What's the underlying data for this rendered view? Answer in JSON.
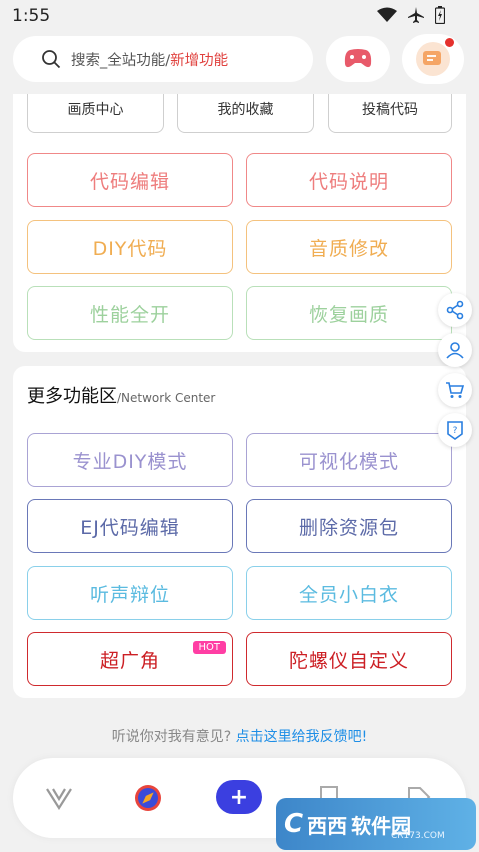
{
  "status": {
    "time": "1:55"
  },
  "search": {
    "placeholder": "搜索_全站功能/",
    "accent": "新增功能"
  },
  "top_tabs": [
    "画质中心",
    "我的收藏",
    "投稿代码"
  ],
  "section1_buttons": [
    {
      "label": "代码编辑",
      "color": "#ee7d7d"
    },
    {
      "label": "代码说明",
      "color": "#ee7d7d"
    },
    {
      "label": "DIY代码",
      "color": "#f0ad52"
    },
    {
      "label": "音质修改",
      "color": "#f0ad52"
    },
    {
      "label": "性能全开",
      "color": "#9dd19d"
    },
    {
      "label": "恢复画质",
      "color": "#9dd19d"
    }
  ],
  "section2": {
    "title": "更多功能区",
    "subtitle": "/Network Center",
    "buttons": [
      {
        "label": "专业DIY模式",
        "color": "#9a92cf"
      },
      {
        "label": "可视化模式",
        "color": "#9a92cf"
      },
      {
        "label": "EJ代码编辑",
        "color": "#5c6aa8"
      },
      {
        "label": "删除资源包",
        "color": "#5c6aa8"
      },
      {
        "label": "听声辩位",
        "color": "#5bbbe0"
      },
      {
        "label": "全员小白衣",
        "color": "#5bbbe0"
      },
      {
        "label": "超广角",
        "color": "#cc1f24",
        "badge": "HOT"
      },
      {
        "label": "陀螺仪自定义",
        "color": "#cc1f24"
      }
    ]
  },
  "floating_icons": [
    "share-icon",
    "user-icon",
    "cart-icon",
    "help-icon"
  ],
  "feedback": {
    "text": "听说你对我有意见? ",
    "link": "点击这里给我反馈吧!"
  },
  "bottom_nav": {
    "plus": "+",
    "items": [
      "v-logo-icon",
      "compass-icon",
      "plus-icon",
      "bookmark-icon",
      "tag-icon"
    ]
  },
  "watermark": {
    "logo": "C",
    "brand": "西西",
    "name": "软件园",
    "url": "CR173.COM"
  },
  "colors": {
    "accent": "#e0413e",
    "link": "#1e8ee6",
    "primary": "#3b3fe0"
  }
}
